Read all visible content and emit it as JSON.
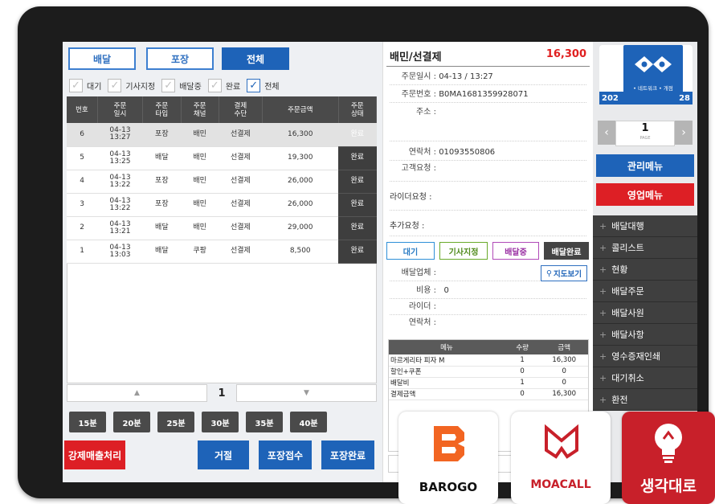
{
  "tabs": [
    "배달",
    "포장",
    "전체"
  ],
  "filters": [
    {
      "label": "대기",
      "checked": false
    },
    {
      "label": "기사지정",
      "checked": false
    },
    {
      "label": "배달중",
      "checked": false
    },
    {
      "label": "완료",
      "checked": true
    },
    {
      "label": "전체",
      "checked": false
    }
  ],
  "table": {
    "headers": [
      "번호",
      "주문\n일시",
      "주문\n타입",
      "주문\n채널",
      "결제\n수단",
      "주문금액",
      "주문\n상태"
    ],
    "rows": [
      [
        "6",
        "04-13\n13:27",
        "포장",
        "배민",
        "선결제",
        "16,300",
        "완료"
      ],
      [
        "5",
        "04-13\n13:25",
        "배달",
        "배민",
        "선결제",
        "19,300",
        "완료"
      ],
      [
        "4",
        "04-13\n13:22",
        "포장",
        "배민",
        "선결제",
        "26,000",
        "완료"
      ],
      [
        "3",
        "04-13\n13:22",
        "포장",
        "배민",
        "선결제",
        "26,000",
        "완료"
      ],
      [
        "2",
        "04-13\n13:21",
        "배달",
        "배민",
        "선결제",
        "29,000",
        "완료"
      ],
      [
        "1",
        "04-13\n13:03",
        "배달",
        "쿠팡",
        "선결제",
        "8,500",
        "완료"
      ]
    ]
  },
  "pager": {
    "up": "▲",
    "page": "1",
    "down": "▼"
  },
  "time_buttons": [
    "15분",
    "20분",
    "25분",
    "30분",
    "35분",
    "40분"
  ],
  "bottom_buttons": {
    "force": "강제매출처리",
    "reject": "거절",
    "accept": "포장접수",
    "done": "포장완료"
  },
  "detail": {
    "title": "배민/선결제",
    "amount": "16,300",
    "order_time_label": "주문일시 :",
    "order_time": "04-13 / 13:27",
    "order_no_label": "주문번호 :",
    "order_no": "B0MA1681359928071",
    "address_label": "주소 :",
    "contact_label": "연락처 :",
    "contact": "01093550806",
    "customer_req_label": "고객요청 :",
    "rider_req_label": "라이더요청 :",
    "extra_req_label": "추가요청 :",
    "status_buttons": [
      "대기",
      "기사지정",
      "배달중",
      "배달완료"
    ],
    "company_label": "배달업체 :",
    "map_button": "지도보기",
    "cost_label": "비용 :",
    "cost": "0",
    "rider_label": "라이더 :",
    "rider_contact_label": "연락처 :",
    "menu_headers": [
      "메뉴",
      "수량",
      "금액"
    ],
    "menu_rows": [
      [
        "마르게리타 피자 M",
        "1",
        "16,300"
      ],
      [
        "할인+쿠폰",
        "0",
        "0"
      ],
      [
        "배달비",
        "1",
        "0"
      ],
      [
        "결제금액",
        "0",
        "16,300"
      ]
    ]
  },
  "right": {
    "logo_status": "• 네트워크 • 개점",
    "logo_date_left": "202",
    "logo_date_right": "28",
    "page": "1",
    "page_sub": "PAGE",
    "admin_menu": "관리메뉴",
    "sales_menu": "영업메뉴",
    "menu_items": [
      "배달대행",
      "콜리스트",
      "현황",
      "배달주문",
      "배달사원",
      "배달사항",
      "영수증재인쇄",
      "대기취소",
      "환전"
    ]
  },
  "brands": {
    "barogo": "BAROGO",
    "moacall": "MOACALL",
    "thinking": "생각대로"
  },
  "colors": {
    "blue": "#1e63b8",
    "red": "#dd1f25",
    "dark": "#3f3f3f",
    "barogo": "#f26522",
    "moacall": "#c8202a",
    "thinking": "#c8202a"
  }
}
